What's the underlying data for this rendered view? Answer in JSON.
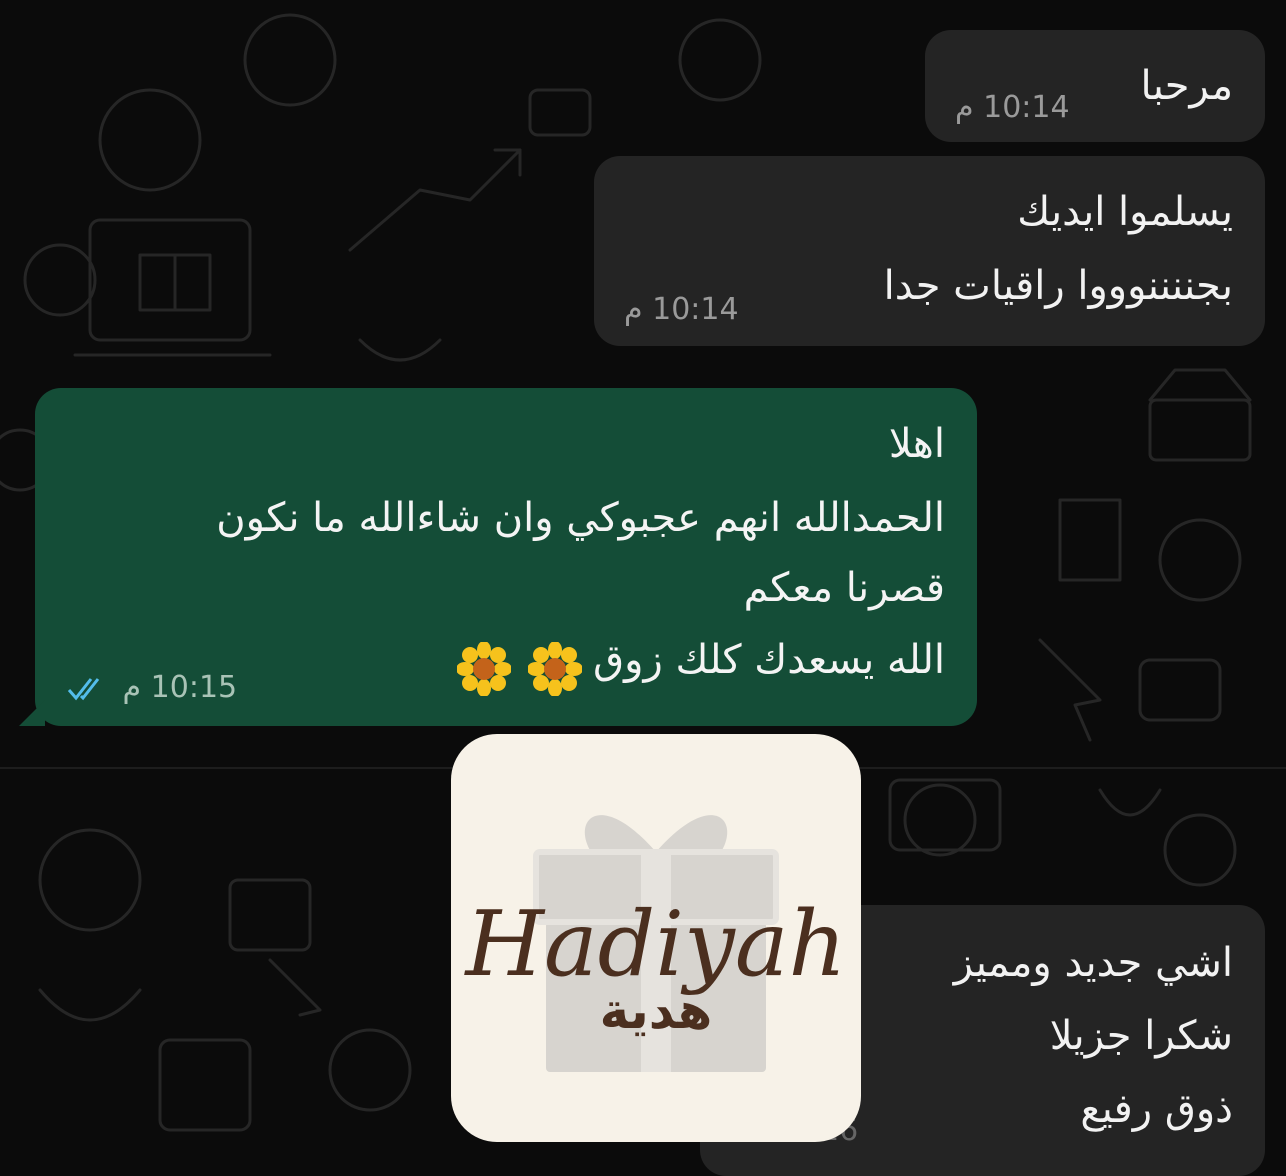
{
  "chat": {
    "messages": [
      {
        "lines": [
          "مرحبا"
        ],
        "time": "10:14 م"
      },
      {
        "lines": [
          "يسلموا ايديك",
          "بجننننوووا راقيات جدا"
        ],
        "time": "10:14 م"
      },
      {
        "lines": [
          "اهلا",
          "الحمدالله انهم عجبوكي وان شاءالله ما نكون",
          "قصرنا معكم",
          "الله يسعدك كلك زوق"
        ],
        "time": "10:15 م"
      },
      {
        "lines": [
          "اشي جديد ومميز",
          "شكرا جزيلا",
          "ذوق رفيع"
        ],
        "time": "16"
      }
    ]
  },
  "logo": {
    "name_en": "Hadiyah",
    "name_ar": "هدية"
  },
  "icons": {
    "read_receipt": "double-check-icon",
    "emoji": "sunflower-emoji"
  },
  "colors": {
    "incoming_bubble": "#242424",
    "outgoing_bubble": "#144d37",
    "logo_bg": "#f7f2e8",
    "logo_text": "#4b2f1f"
  }
}
